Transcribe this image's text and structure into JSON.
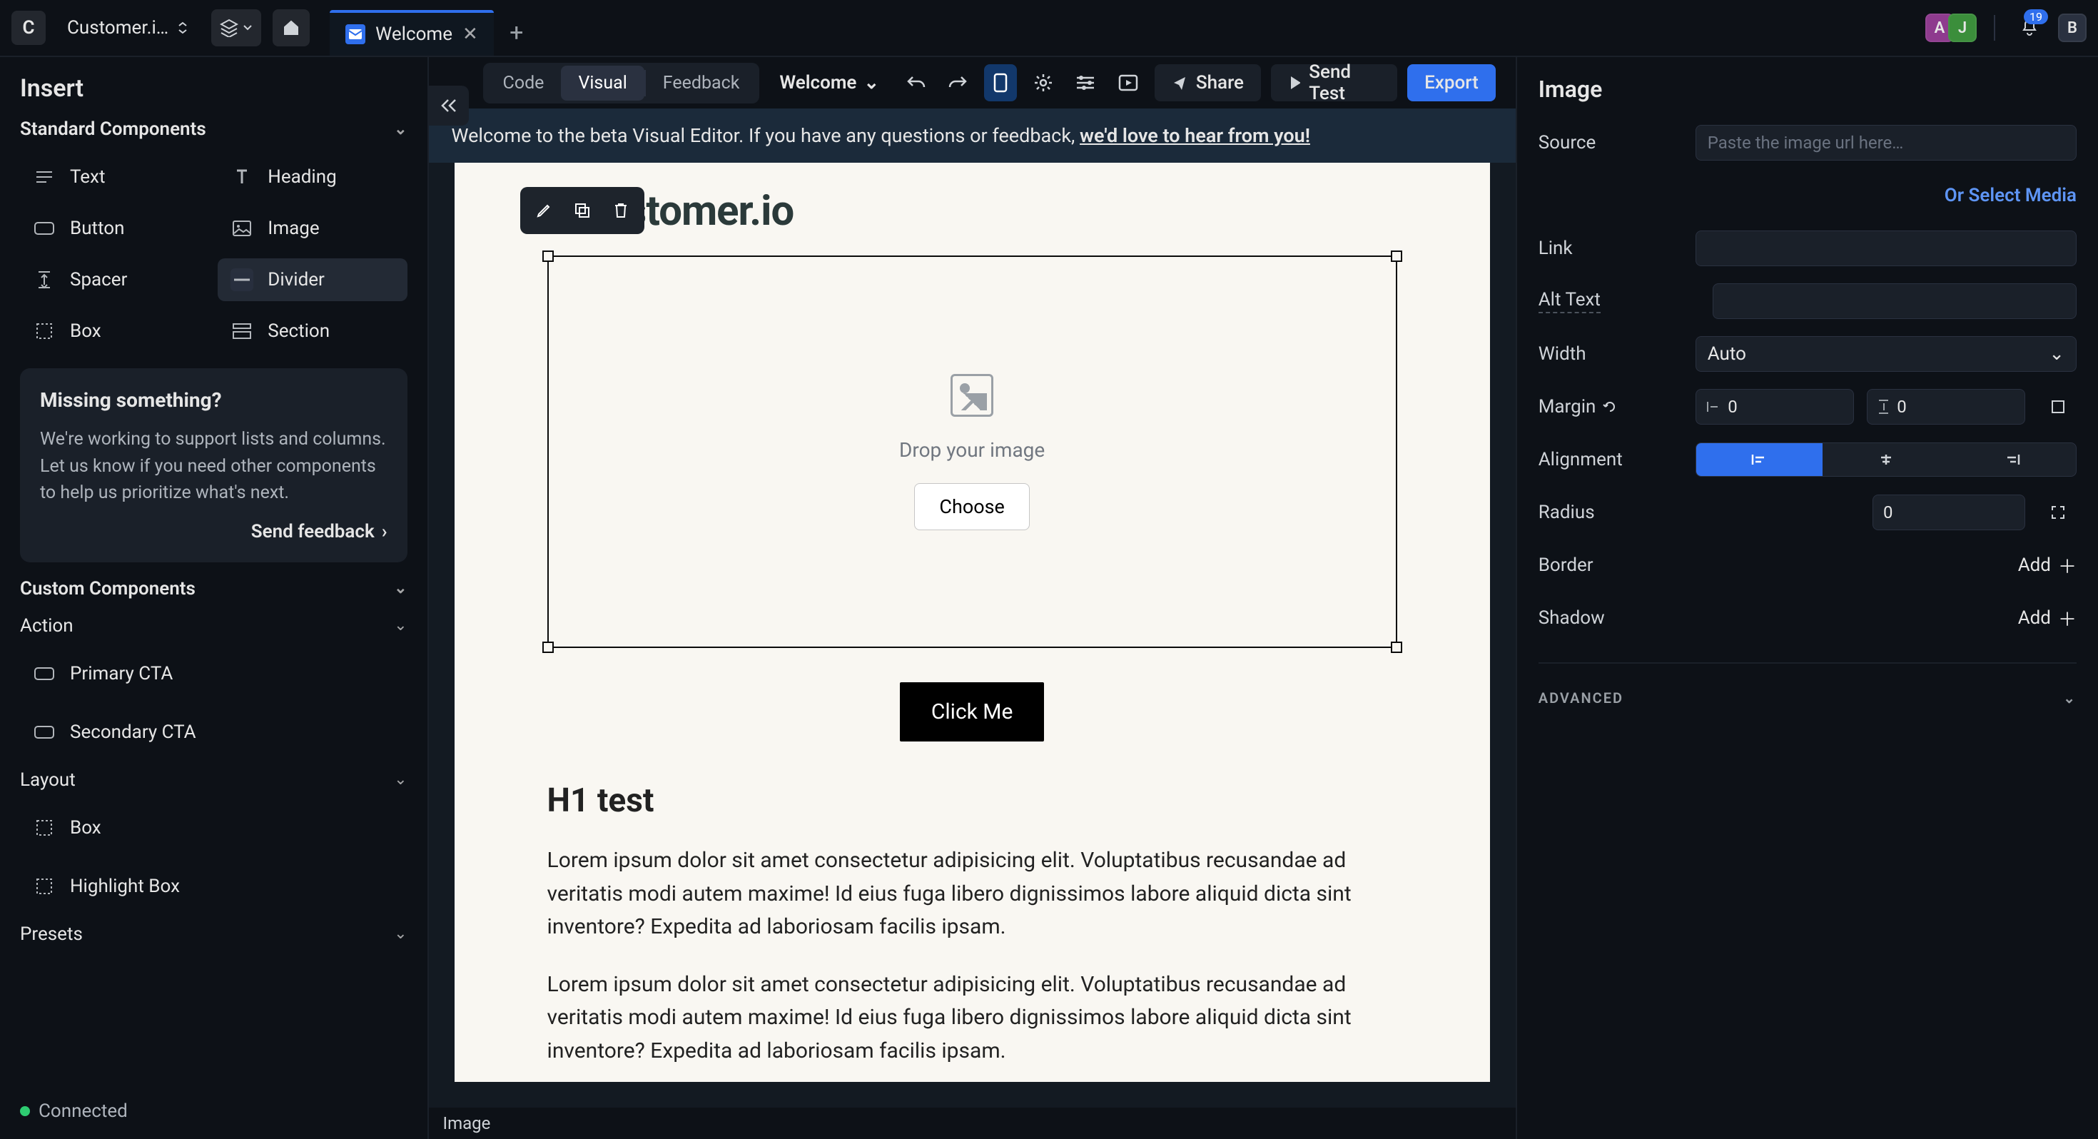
{
  "header": {
    "project_badge": "C",
    "project_name": "Customer.i…",
    "tab_label": "Welcome",
    "notification_count": "19",
    "avatars": [
      "A",
      "J",
      "B"
    ]
  },
  "left": {
    "title": "Insert",
    "standard_header": "Standard Components",
    "components": {
      "text": "Text",
      "heading": "Heading",
      "button": "Button",
      "image": "Image",
      "spacer": "Spacer",
      "divider": "Divider",
      "box": "Box",
      "section": "Section"
    },
    "note": {
      "title": "Missing something?",
      "body": "We're working to support lists and columns. Let us know if you need other components to help us prioritize what's next.",
      "link": "Send feedback"
    },
    "custom_header": "Custom Components",
    "action_header": "Action",
    "action_items": {
      "primary": "Primary CTA",
      "secondary": "Secondary CTA"
    },
    "layout_header": "Layout",
    "layout_items": {
      "box": "Box",
      "highlight": "Highlight Box"
    },
    "presets_header": "Presets",
    "status": "Connected"
  },
  "toolbar": {
    "code": "Code",
    "visual": "Visual",
    "feedback": "Feedback",
    "doc_title": "Welcome",
    "share": "Share",
    "send_test": "Send Test",
    "export": "Export"
  },
  "banner": {
    "text": "Welcome to the beta Visual Editor. If you have any questions or feedback, ",
    "link": "we'd love to hear from you!"
  },
  "canvas": {
    "brand": "stomer.io",
    "drop_text": "Drop your image",
    "choose": "Choose",
    "cta": "Click Me",
    "h1": "H1 test",
    "p1": "Lorem ipsum dolor sit amet consectetur adipisicing elit. Voluptatibus recusandae ad veritatis modi autem maxime! Id eius fuga libero dignissimos labore aliquid dicta sint inventore? Expedita ad laboriosam facilis ipsam.",
    "p2": "Lorem ipsum dolor sit amet consectetur adipisicing elit. Voluptatibus recusandae ad veritatis modi autem maxime! Id eius fuga libero dignissimos labore aliquid dicta sint inventore? Expedita ad laboriosam facilis ipsam.",
    "footer": "Image"
  },
  "right": {
    "title": "Image",
    "labels": {
      "source": "Source",
      "link": "Link",
      "alt": "Alt Text",
      "width": "Width",
      "margin": "Margin",
      "alignment": "Alignment",
      "radius": "Radius",
      "border": "Border",
      "shadow": "Shadow"
    },
    "source_placeholder": "Paste the image url here…",
    "media_link": "Or Select Media",
    "width_value": "Auto",
    "margin_h": "0",
    "margin_v": "0",
    "radius": "0",
    "add": "Add",
    "advanced": "ADVANCED"
  }
}
